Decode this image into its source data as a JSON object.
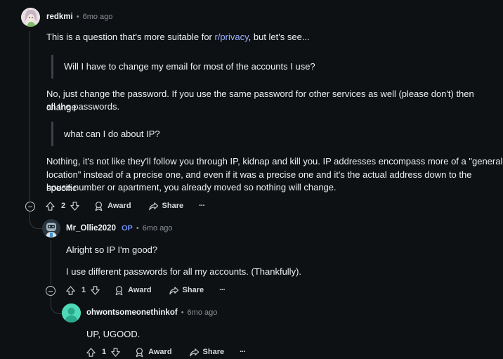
{
  "comments": [
    {
      "author": "redkmi",
      "time": "6mo ago",
      "para1_pre": "This is a question that's more suitable for ",
      "para1_link": "r/privacy",
      "para1_post": ", but let's see...",
      "quote1": "Will I have to change my email for most of the accounts I use?",
      "para2_line1": "No, just change the password. If you use the same password for other services as well (please don't) then change",
      "para2_line2": "all the passwords.",
      "quote2": "what can I do about IP?",
      "para3_line1": "Nothing, it's not like they'll follow you through IP, kidnap and kill you. IP addresses encompass more of a \"general",
      "para3_line2": "location\" instead of a precise one, and even if it was a precise one and it's the actual address down to the specific",
      "para3_line3": "house number or apartment, you already moved so nothing will change.",
      "votes": "2",
      "award_label": "Award",
      "share_label": "Share",
      "more_label": "···"
    },
    {
      "author": "Mr_Ollie2020",
      "op_badge": "OP",
      "time": "6mo ago",
      "para1": "Alright so IP I'm good?",
      "para2": "I use different passwords for all my accounts. (Thankfully).",
      "votes": "1",
      "award_label": "Award",
      "share_label": "Share",
      "more_label": "···"
    },
    {
      "author": "ohwontsomeonethinkof",
      "time": "6mo ago",
      "para1": "UP, UGOOD.",
      "votes": "1",
      "award_label": "Award",
      "share_label": "Share",
      "more_label": "···"
    }
  ],
  "meta_separator": "•",
  "colors": {
    "background": "#0e1113",
    "link": "#9bb0ff",
    "op_badge": "#6f8ff5",
    "thread_line": "#343a40"
  }
}
